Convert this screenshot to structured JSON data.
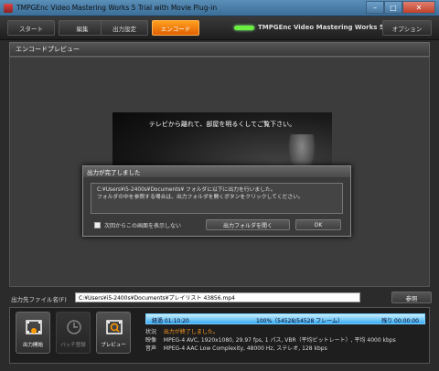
{
  "window": {
    "title": "TMPGEnc Video Mastering Works 5 Trial with Movie Plug-in",
    "minimize": "–",
    "maximize": "□",
    "close": "✕"
  },
  "tabs": [
    {
      "label": "スタート"
    },
    {
      "label": "編集"
    },
    {
      "label": "出力設定"
    },
    {
      "label": "エンコード",
      "active": true
    }
  ],
  "brand": "TMPGEnc Video Mastering Works 5",
  "options_label": "オプション",
  "section_title": "エンコードプレビュー",
  "preview": {
    "caption": "テレビから離れて、部屋を明るくしてご覧下さい。"
  },
  "dialog": {
    "title": "出力が完了しました",
    "line1": "C:¥Users¥i5-2400s¥Documents¥ フォルダに以下に出力を行いました。",
    "line2": "フォルダの中を参照する場合は、出力フォルダを開くボタンをクリックしてください。",
    "checkbox_label": "次回からこの画面を表示しない",
    "open_folder_label": "出力フォルダを開く",
    "ok_label": "OK"
  },
  "output": {
    "label": "出力先ファイル名(F)",
    "path": "C:¥Users¥i5-2400s¥Documents¥プレイリスト 43856.mp4",
    "browse_label": "参照"
  },
  "actions": {
    "start": "出力開始",
    "batch": "バッチ登録",
    "preview": "プレビュー"
  },
  "progress": {
    "elapsed": "経過 01:10:20",
    "frames": "100%（54528/54528 フレーム）",
    "remaining": "残り 00:00:00",
    "fraction": 1.0
  },
  "status": {
    "state_label": "状況",
    "state_value": "出力が終了しました。",
    "video_label": "映像",
    "video_value": "MPEG-4 AVC, 1920x1080, 29.97 fps, 1 パス, VBR（平均ビットレート）, 平均 4000 kbps",
    "audio_label": "音声",
    "audio_value": "MPEG-4 AAC Low Complexity, 48000 Hz, ステレオ, 128 kbps"
  },
  "colors": {
    "accent": "#f07010",
    "progress": "#2a9ee0",
    "status_orange": "#ff9a20"
  }
}
